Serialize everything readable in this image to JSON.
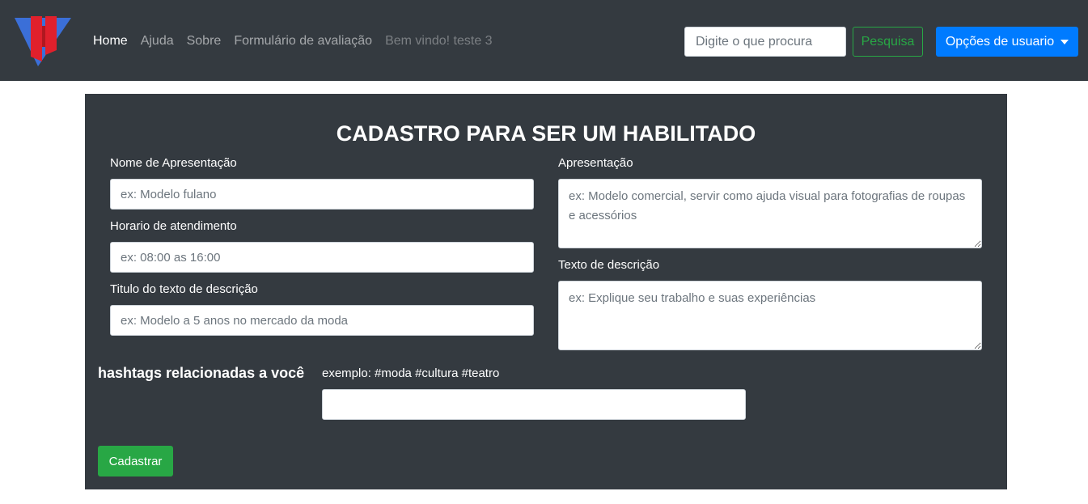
{
  "navbar": {
    "links": [
      {
        "label": "Home"
      },
      {
        "label": "Ajuda"
      },
      {
        "label": "Sobre"
      },
      {
        "label": "Formulário de avaliação"
      }
    ],
    "welcome_text": "Bem vindo! teste 3",
    "search": {
      "placeholder": "Digite o que procura",
      "value": ""
    },
    "search_button_label": "Pesquisa",
    "user_menu_label": "Opções de usuario"
  },
  "form": {
    "title": "CADASTRO PARA SER UM HABILITADO",
    "nome": {
      "label": "Nome de Apresentação",
      "placeholder": "ex: Modelo fulano"
    },
    "horario": {
      "label": "Horario de atendimento",
      "placeholder": "ex: 08:00 as 16:00"
    },
    "titulo": {
      "label": "Titulo do texto de descrição",
      "placeholder": "ex: Modelo a 5 anos no mercado da moda"
    },
    "apresentacao": {
      "label": "Apresentação",
      "placeholder": "ex: Modelo comercial, servir como ajuda visual para fotografias de roupas e acessórios"
    },
    "descricao": {
      "label": "Texto de descrição",
      "placeholder": "ex: Explique seu trabalho e suas experiências"
    },
    "hashtags": {
      "title": "hashtags relacionadas a você",
      "label": "exemplo: #moda #cultura #teatro",
      "value": ""
    },
    "submit_label": "Cadastrar"
  },
  "colors": {
    "navbar_bg": "#343a40",
    "panel_bg": "#343a40",
    "primary": "#007bff",
    "success": "#28a745"
  },
  "icons": {
    "logo": "brand-logo-icon"
  }
}
